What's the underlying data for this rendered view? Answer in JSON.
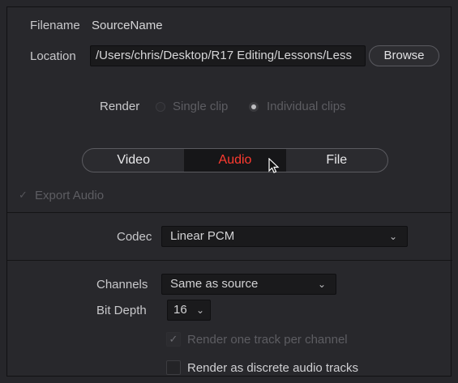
{
  "file": {
    "filename_label": "Filename",
    "filename_value": "SourceName",
    "location_label": "Location",
    "location_value": "/Users/chris/Desktop/R17 Editing/Lessons/Less",
    "browse_label": "Browse"
  },
  "render": {
    "label": "Render",
    "options": [
      "Single clip",
      "Individual clips"
    ],
    "selected": "Individual clips"
  },
  "tabs": {
    "items": [
      "Video",
      "Audio",
      "File"
    ],
    "active": "Audio"
  },
  "audio": {
    "export_audio_label": "Export Audio",
    "export_audio_checked": true,
    "codec_label": "Codec",
    "codec_value": "Linear PCM",
    "channels_label": "Channels",
    "channels_value": "Same as source",
    "bit_depth_label": "Bit Depth",
    "bit_depth_value": "16",
    "track_per_channel_label": "Render one track per channel",
    "track_per_channel_checked": true,
    "discrete_tracks_label": "Render as discrete audio tracks",
    "discrete_tracks_checked": false
  },
  "icons": {
    "checkmark": "✓",
    "chevron": "⌄"
  },
  "colors": {
    "active_tab_text": "#ff3b30",
    "panel_bg": "#28282c"
  }
}
